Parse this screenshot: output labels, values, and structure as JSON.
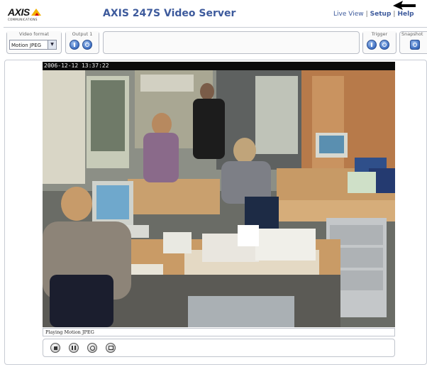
{
  "header": {
    "logo_text": "AXIS",
    "logo_sub": "COMMUNICATIONS",
    "title": "AXIS 247S Video Server",
    "nav": [
      {
        "label": "Live View",
        "active": true
      },
      {
        "label": "Setup",
        "active": false
      },
      {
        "label": "Help",
        "active": false
      }
    ],
    "nav_separator": "|"
  },
  "toolbar": {
    "video_format": {
      "label": "Video format",
      "selected": "Motion JPEG"
    },
    "output": {
      "label": "Output 1",
      "buttons": [
        "output-on-icon",
        "output-off-icon"
      ]
    },
    "trigger": {
      "label": "Trigger",
      "buttons": [
        "trigger-on-icon",
        "trigger-off-icon"
      ]
    },
    "snapshot": {
      "label": "Snapshot",
      "icon": "camera-icon"
    }
  },
  "video": {
    "timestamp": "2006-12-12 13:37:22",
    "status": "Playing Motion JPEG"
  },
  "controls": {
    "buttons": [
      "stop-icon",
      "pause-icon",
      "record-icon",
      "fullscreen-icon"
    ]
  },
  "colors": {
    "title": "#3d5a9c",
    "accent_blue": "#3e6fc2",
    "logo_yellow": "#f2b200",
    "logo_red": "#d40000"
  }
}
